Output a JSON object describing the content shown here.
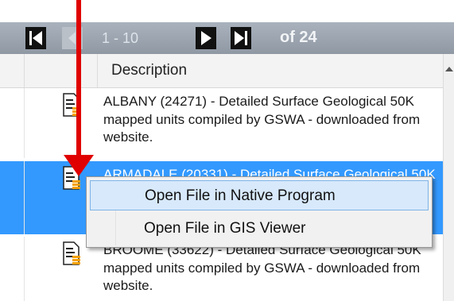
{
  "toolbar": {
    "range_label": "1 - 10",
    "of_label": "of 24"
  },
  "grid": {
    "column_header": "Description",
    "rows": [
      {
        "text": "ALBANY (24271) - Detailed Surface Geological 50K mapped units compiled by GSWA - downloaded from website.",
        "selected": false
      },
      {
        "text": "ARMADALE (20331) - Detailed Surface Geological 50K mapped units compiled by GSWA - downloaded from website.",
        "selected": true
      },
      {
        "text": "BROOME (33622) - Detailed Surface Geological 50K mapped units compiled by GSWA - downloaded from website.",
        "selected": false
      }
    ]
  },
  "context_menu": {
    "items": [
      {
        "label": "Open File in Native Program"
      },
      {
        "label": "Open File in GIS Viewer"
      }
    ]
  },
  "colors": {
    "selection": "#3399ff",
    "arrow": "#e00000",
    "toolbar": "#9aa3ae"
  },
  "icons": [
    "first-page-icon",
    "previous-page-icon",
    "next-page-icon",
    "last-page-icon",
    "document-icon",
    "scroll-up-icon"
  ]
}
